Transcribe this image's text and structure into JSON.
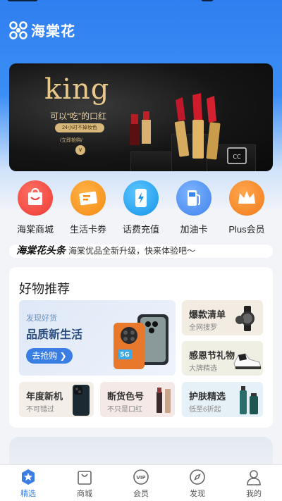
{
  "app": {
    "name": "海棠花"
  },
  "banner": {
    "headline": "king",
    "tagline": "可以“吃”的口红",
    "pill": "24小时不掉妆色",
    "cta": "/立即抢购/",
    "arrow": "∨"
  },
  "quick_actions": [
    {
      "label": "海棠商城",
      "icon": "shopping-bag-icon",
      "color": "#f0463c"
    },
    {
      "label": "生活卡券",
      "icon": "ticket-icon",
      "color": "#f7941d"
    },
    {
      "label": "话费充值",
      "icon": "phone-charge-icon",
      "color": "#1e9bf0"
    },
    {
      "label": "加油卡",
      "icon": "fuel-icon",
      "color": "#4a90f0"
    },
    {
      "label": "Plus会员",
      "icon": "crown-icon",
      "color": "#f5851f"
    }
  ],
  "news": {
    "brand": "海棠花头条",
    "text": "海棠优品全新升级，快来体验吧～"
  },
  "recommend": {
    "title": "好物推荐",
    "feature": {
      "small": "发现好货",
      "big": "品质新生活",
      "button": "去抢购 ❯"
    },
    "cards": [
      {
        "title": "爆款清单",
        "sub": "全网搜罗"
      },
      {
        "title": "感恩节礼物",
        "sub": "大牌精选"
      },
      {
        "title": "年度新机",
        "sub": "不可错过"
      },
      {
        "title": "断货色号",
        "sub": "不只是口红"
      },
      {
        "title": "护肤精选",
        "sub": "低至6折起"
      }
    ]
  },
  "tabs": [
    {
      "label": "精选",
      "icon": "star-badge-icon",
      "active": true
    },
    {
      "label": "商城",
      "icon": "bag-icon",
      "active": false
    },
    {
      "label": "会员",
      "icon": "vip-icon",
      "active": false
    },
    {
      "label": "发现",
      "icon": "compass-icon",
      "active": false
    },
    {
      "label": "我的",
      "icon": "profile-icon",
      "active": false
    }
  ],
  "colors": {
    "accent": "#3a7de3",
    "header": "#2f7ff0"
  }
}
